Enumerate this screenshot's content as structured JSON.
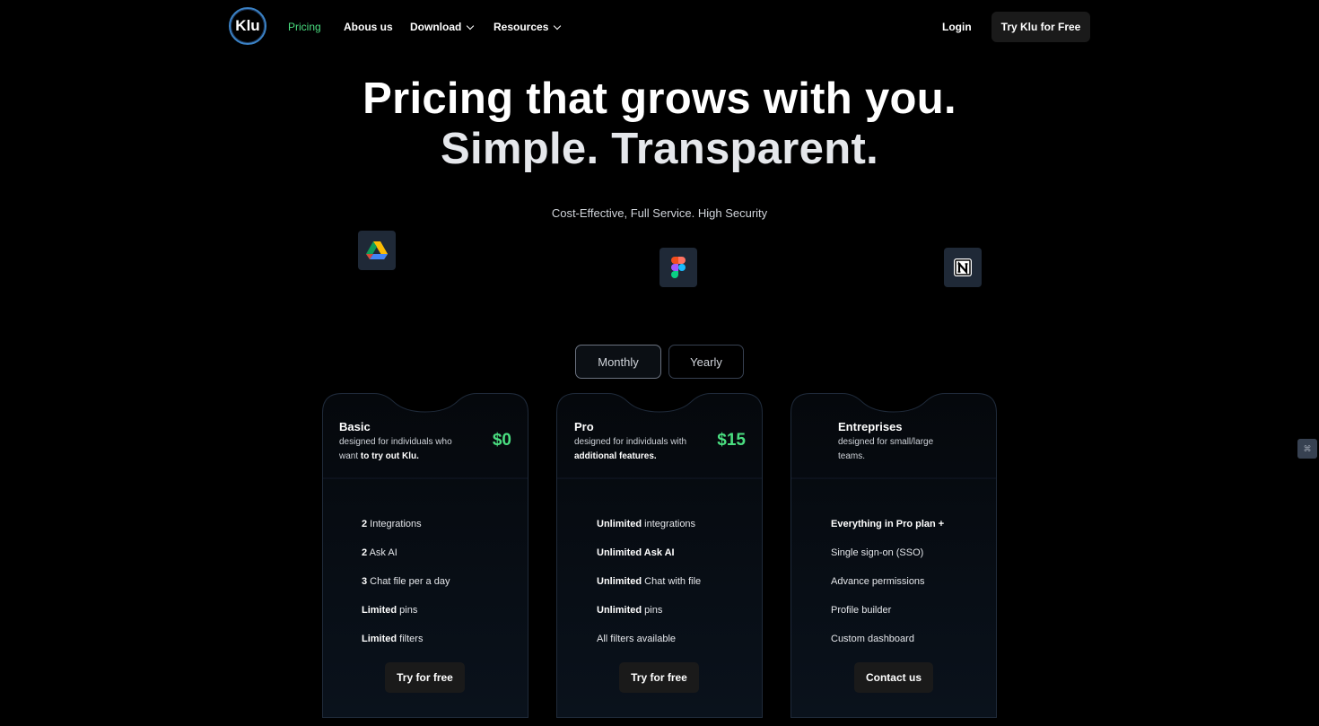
{
  "nav": {
    "logo_text": "Klu",
    "links": [
      "Pricing",
      "Abous us",
      "Download",
      "Resources"
    ],
    "login": "Login",
    "cta": "Try Klu for Free"
  },
  "hero": {
    "title_line1": "Pricing that grows with you.",
    "title_line2": "Simple. Transparent.",
    "subtitle": "Cost-Effective, Full Service. High Security"
  },
  "integration_icons": [
    "google-drive-icon",
    "figma-icon",
    "notion-icon"
  ],
  "billing_toggle": {
    "monthly": "Monthly",
    "yearly": "Yearly",
    "selected": "Monthly"
  },
  "plans": [
    {
      "name": "Basic",
      "desc_plain": "designed for individuals who want ",
      "desc_bold": "to try out Klu.",
      "price": "$0",
      "features": [
        {
          "bold": "2",
          "text": " Integrations"
        },
        {
          "bold": "2",
          "text": " Ask AI"
        },
        {
          "bold": "3",
          "text": " Chat file per a day"
        },
        {
          "bold": "Limited",
          "text": " pins"
        },
        {
          "bold": "Limited",
          "text": " filters"
        }
      ],
      "button": "Try for free"
    },
    {
      "name": "Pro",
      "desc_plain": "designed for individuals with ",
      "desc_bold": "additional features.",
      "price": "$15",
      "features": [
        {
          "bold": "Unlimited",
          "text": " integrations"
        },
        {
          "bold": "Unlimited Ask AI",
          "text": ""
        },
        {
          "bold": "Unlimited",
          "text": " Chat with file"
        },
        {
          "bold": "Unlimited",
          "text": " pins"
        },
        {
          "bold": "",
          "text": "All filters available"
        }
      ],
      "button": "Try for free"
    },
    {
      "name": "Entreprises",
      "desc_plain": "designed for small/large teams.",
      "desc_bold": "",
      "price": "",
      "features": [
        {
          "bold": "Everything in Pro plan +",
          "text": ""
        },
        {
          "bold": "",
          "text": "Single sign-on (SSO)"
        },
        {
          "bold": "",
          "text": "Advance permissions"
        },
        {
          "bold": "",
          "text": "Profile builder"
        },
        {
          "bold": "",
          "text": "Custom dashboard"
        }
      ],
      "button": "Contact us"
    }
  ],
  "colors": {
    "accent_green": "#4ade80",
    "background": "#000000",
    "logo_ring": "#3b82c6"
  }
}
